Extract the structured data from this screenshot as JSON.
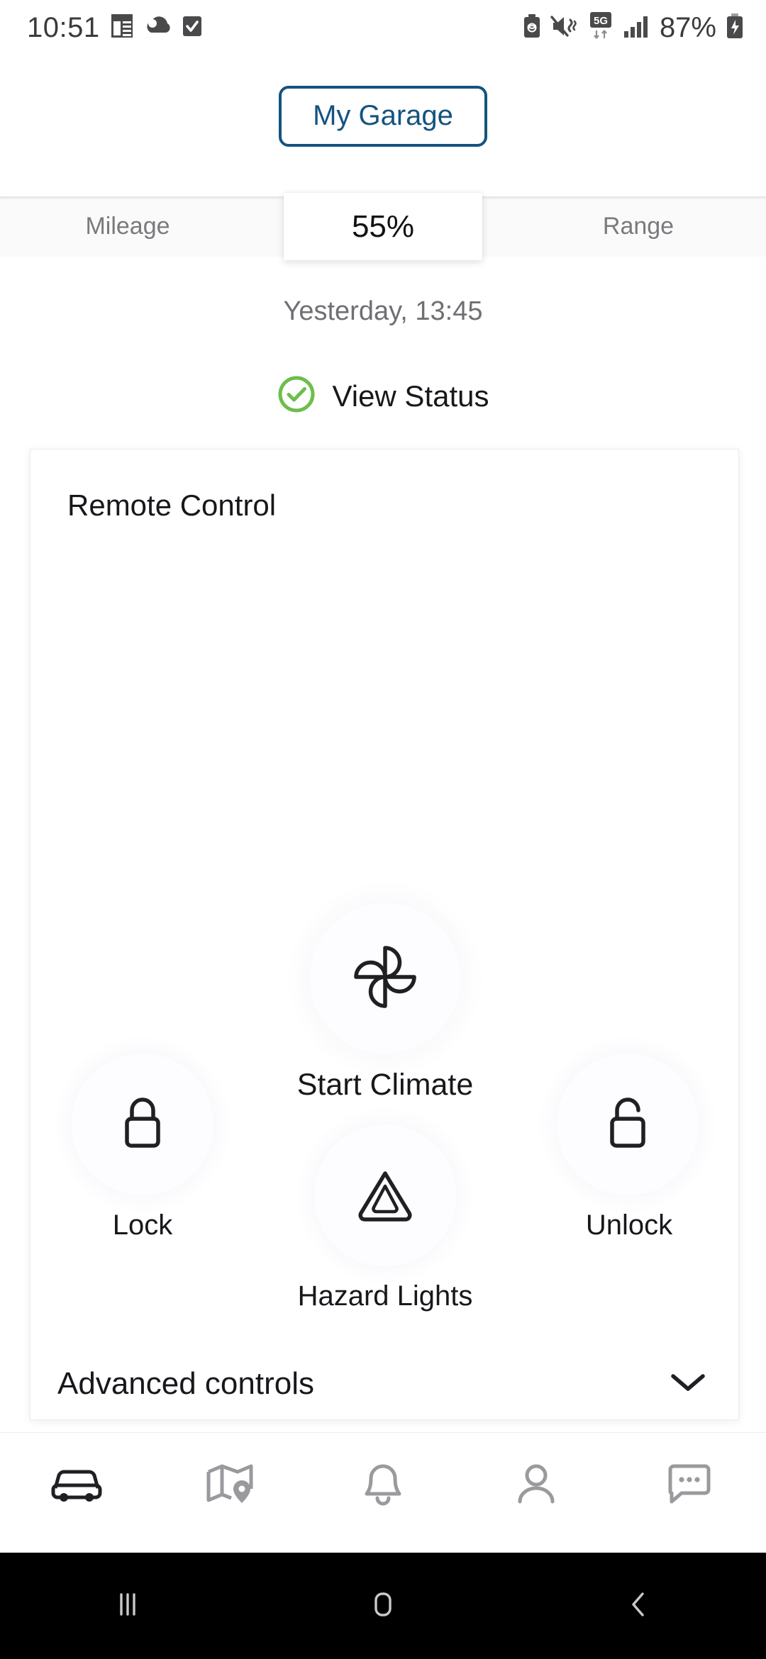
{
  "statusbar": {
    "time": "10:51",
    "battery_percent": "87%",
    "left_icons": [
      "calendar-icon",
      "weather-cloud-icon",
      "checkbox-checked-icon"
    ],
    "right_icons": [
      "battery-saver-icon",
      "vibrate-mute-icon",
      "5g-network-icon",
      "signal-bars-icon",
      "charging-battery-icon"
    ],
    "network_label": "5G"
  },
  "header": {
    "garage_button_label": "My Garage"
  },
  "stats": {
    "cells": [
      {
        "label": "Mileage",
        "active": false
      },
      {
        "label": "55%",
        "active": true
      },
      {
        "label": "Range",
        "active": false
      }
    ],
    "mileage_label": "Mileage",
    "battery_label": "55%",
    "range_label": "Range"
  },
  "vehicle": {
    "last_updated": "Yesterday, 13:45",
    "view_status_label": "View Status",
    "status_ok_color": "#6DBE4B"
  },
  "remote_control": {
    "title": "Remote Control",
    "climate": {
      "label": "Start Climate",
      "icon": "fan-pinwheel-icon"
    },
    "lock": {
      "label": "Lock",
      "icon": "lock-closed-icon"
    },
    "unlock": {
      "label": "Unlock",
      "icon": "lock-open-icon"
    },
    "hazard": {
      "label": "Hazard Lights",
      "icon": "hazard-triangle-icon"
    },
    "advanced": {
      "label": "Advanced controls",
      "icon": "chevron-down-icon"
    }
  },
  "tabbar": {
    "items": [
      {
        "name": "vehicle",
        "icon": "car-icon",
        "active": true
      },
      {
        "name": "map",
        "icon": "map-pin-icon",
        "active": false
      },
      {
        "name": "notifications",
        "icon": "bell-icon",
        "active": false
      },
      {
        "name": "profile",
        "icon": "person-icon",
        "active": false
      },
      {
        "name": "messages",
        "icon": "chat-bubble-icon",
        "active": false
      }
    ]
  },
  "navbar": {
    "items": [
      {
        "name": "recents",
        "icon": "recents-icon"
      },
      {
        "name": "home",
        "icon": "home-icon"
      },
      {
        "name": "back",
        "icon": "back-icon"
      }
    ]
  },
  "colors": {
    "brand_blue": "#14537f",
    "status_green": "#6DBE4B",
    "text_primary": "#17181b",
    "text_secondary": "#7a7a7e"
  }
}
